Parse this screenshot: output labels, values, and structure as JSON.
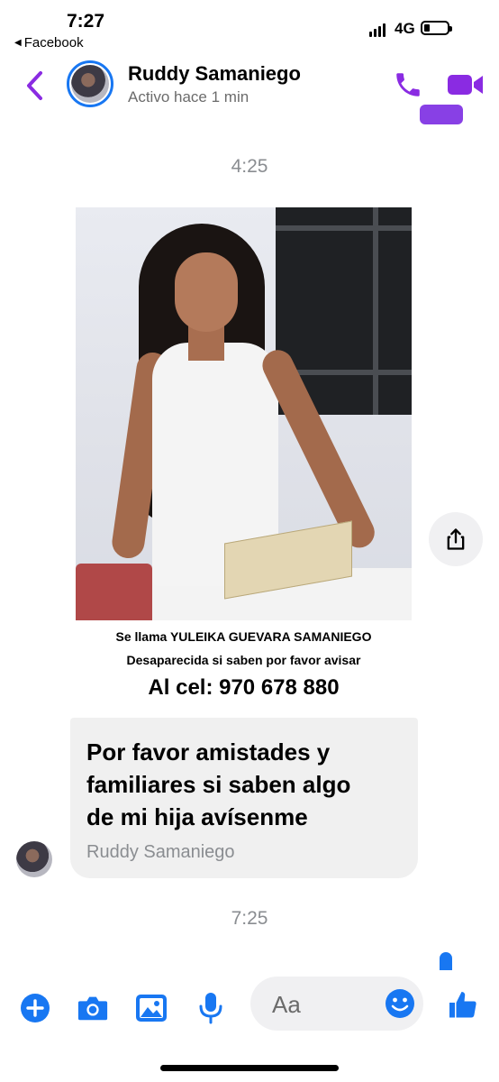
{
  "status_bar": {
    "time": "7:27",
    "back_app": "Facebook",
    "network": "4G"
  },
  "header": {
    "contact_name": "Ruddy Samaniego",
    "contact_status": "Activo hace 1 min"
  },
  "thread": {
    "timestamp_1": "4:25",
    "photo_caption": {
      "line1": "Se llama YULEIKA GUEVARA SAMANIEGO",
      "line2": "Desaparecida si saben por favor avisar",
      "line3": "Al cel: 970 678 880"
    },
    "message": {
      "line1": "Por favor amistades y",
      "line2": "familiares si saben algo",
      "line3": "de mi hija avísenme",
      "sender": "Ruddy Samaniego"
    },
    "timestamp_2": "7:25"
  },
  "composer": {
    "placeholder": "Aa"
  },
  "icons": {
    "back": "chevron-left-icon",
    "call": "phone-icon",
    "video": "video-camera-icon",
    "share": "share-icon",
    "plus": "plus-icon",
    "camera": "camera-icon",
    "gallery": "image-icon",
    "mic": "microphone-icon",
    "emoji": "emoji-icon",
    "like": "thumbs-up-icon"
  },
  "colors": {
    "accent_purple": "#8a2be2",
    "accent_blue": "#1877f2",
    "bubble_bg": "#f0f0f0",
    "muted_text": "#8a8d91"
  }
}
